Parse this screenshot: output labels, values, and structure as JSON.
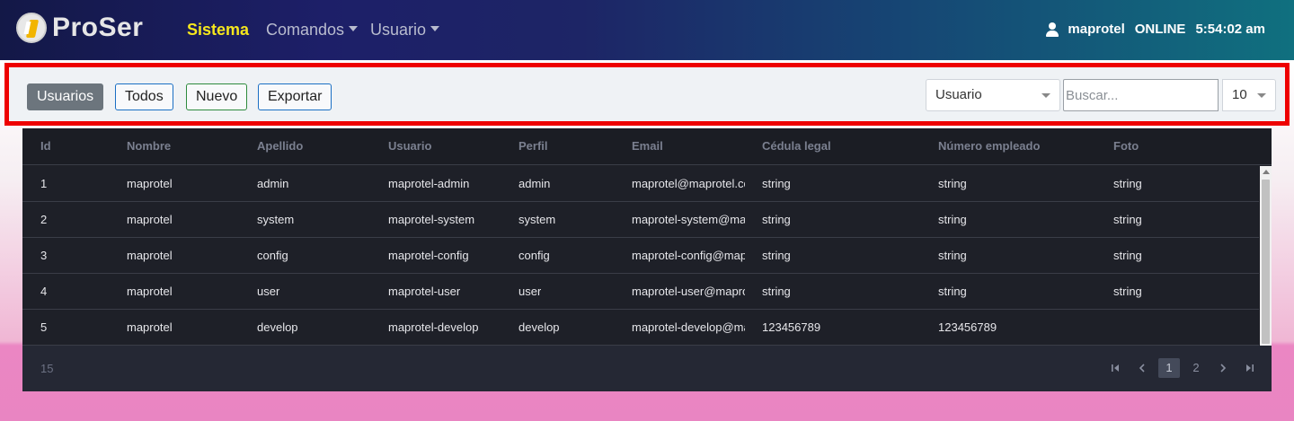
{
  "brand": {
    "name": "ProSer"
  },
  "nav": {
    "items": [
      {
        "label": "Sistema",
        "active": true
      },
      {
        "label": "Comandos",
        "dropdown": true
      },
      {
        "label": "Usuario",
        "dropdown": true
      }
    ],
    "user": {
      "name": "maprotel",
      "status": "ONLINE",
      "time": "5:54:02 am"
    }
  },
  "toolbar": {
    "buttons": {
      "usuarios": "Usuarios",
      "todos": "Todos",
      "nuevo": "Nuevo",
      "exportar": "Exportar"
    },
    "field_select": "Usuario",
    "search_placeholder": "Buscar...",
    "page_size": "10"
  },
  "table": {
    "columns": [
      "Id",
      "Nombre",
      "Apellido",
      "Usuario",
      "Perfil",
      "Email",
      "Cédula legal",
      "Número empleado",
      "Foto"
    ],
    "rows": [
      [
        "1",
        "maprotel",
        "admin",
        "maprotel-admin",
        "admin",
        "maprotel@maprotel.com",
        "string",
        "string",
        "string"
      ],
      [
        "2",
        "maprotel",
        "system",
        "maprotel-system",
        "system",
        "maprotel-system@maprotel.com",
        "string",
        "string",
        "string"
      ],
      [
        "3",
        "maprotel",
        "config",
        "maprotel-config",
        "config",
        "maprotel-config@maprotel.com",
        "string",
        "string",
        "string"
      ],
      [
        "4",
        "maprotel",
        "user",
        "maprotel-user",
        "user",
        "maprotel-user@maprotel.com",
        "string",
        "string",
        "string"
      ],
      [
        "5",
        "maprotel",
        "develop",
        "maprotel-develop",
        "develop",
        "maprotel-develop@maprotel.com",
        "123456789",
        "123456789",
        ""
      ]
    ],
    "total": "15",
    "pages": [
      "1",
      "2"
    ],
    "current_page": "1"
  },
  "colors": {
    "highlight_border": "#ee0000",
    "nav_active": "#f5e61d"
  }
}
